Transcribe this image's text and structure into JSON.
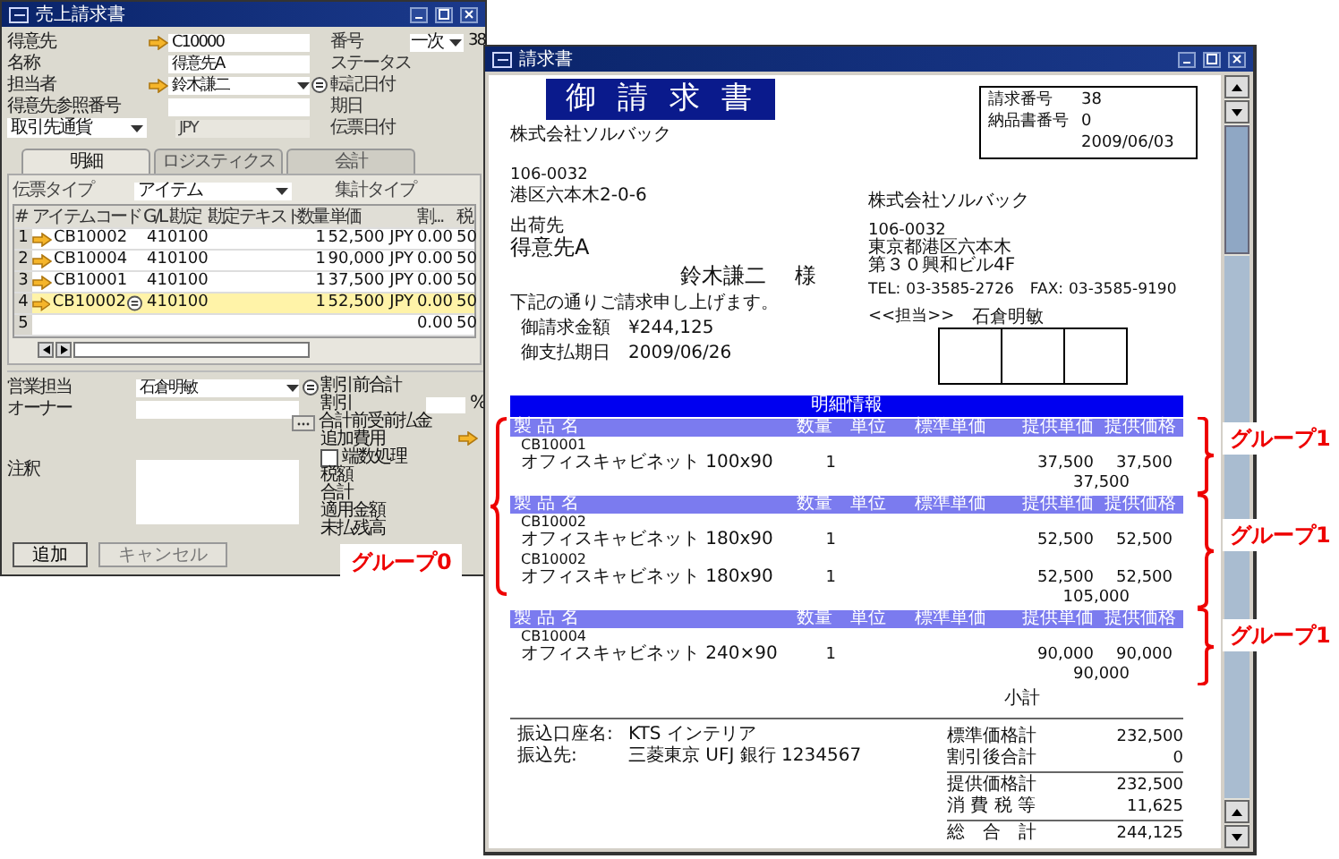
{
  "back_window": {
    "title": "売上請求書",
    "header_left": [
      {
        "label": "得意先",
        "value": "C10000",
        "kind": "link"
      },
      {
        "label": "名称",
        "value": "得意先A",
        "kind": "text"
      },
      {
        "label": "担当者",
        "value": "鈴木謙二",
        "kind": "link-select"
      },
      {
        "label": "得意先参照番号",
        "kind": "text"
      },
      {
        "label": "取引先通貨",
        "value": "JPY",
        "kind": "select-label"
      }
    ],
    "header_right": [
      {
        "label": "番号",
        "value": "一次",
        "extra": "38",
        "kind": "select"
      },
      {
        "label": "ステータス",
        "kind": "plain"
      },
      {
        "label": "転記日付",
        "kind": "plain"
      },
      {
        "label": "期日",
        "kind": "plain"
      },
      {
        "label": "伝票日付",
        "kind": "plain"
      }
    ],
    "tabs": [
      {
        "label": "明細",
        "selected": true
      },
      {
        "label": "ロジスティクス",
        "selected": false
      },
      {
        "label": "会計",
        "selected": false
      }
    ],
    "doc_type": {
      "label": "伝票タイプ",
      "value": "アイテム"
    },
    "summary_type": {
      "label": "集計タイプ"
    },
    "table": {
      "columns": [
        "#",
        "アイテムコード",
        "G/L 勘定",
        "勘定テキスト",
        "数量",
        "単価",
        "割...",
        "税"
      ],
      "rows": [
        {
          "cells": [
            "1",
            "CB10002",
            "410100",
            "",
            "1",
            "52,500 JPY",
            "0.00",
            "50"
          ],
          "selected": false
        },
        {
          "cells": [
            "2",
            "CB10004",
            "410100",
            "",
            "1",
            "90,000 JPY",
            "0.00",
            "50"
          ],
          "selected": false
        },
        {
          "cells": [
            "3",
            "CB10001",
            "410100",
            "",
            "1",
            "37,500 JPY",
            "0.00",
            "50"
          ],
          "selected": false
        },
        {
          "cells": [
            "4",
            "CB10002",
            "410100",
            "",
            "1",
            "52,500 JPY",
            "0.00",
            "50"
          ],
          "selected": true
        },
        {
          "cells": [
            "5",
            "",
            "",
            "",
            "",
            "",
            "0.00",
            "50"
          ],
          "selected": false
        }
      ]
    },
    "bottom_left": [
      {
        "label": "営業担当",
        "value": "石倉明敏",
        "kind": "select"
      },
      {
        "label": "オーナー",
        "kind": "text"
      },
      {
        "label": "注釈",
        "kind": "textarea"
      }
    ],
    "totals": [
      {
        "label": "割引前合計",
        "kind": "plain"
      },
      {
        "label": "割引",
        "kind": "percent",
        "unit": "%"
      },
      {
        "label": "合計前受前払金",
        "kind": "button"
      },
      {
        "label": "追加費用",
        "kind": "link"
      },
      {
        "label": "端数処理",
        "kind": "checkbox",
        "checked": false
      },
      {
        "label": "税額",
        "kind": "plain"
      },
      {
        "label": "合計",
        "kind": "plain"
      },
      {
        "label": "適用金額",
        "kind": "plain"
      },
      {
        "label": "未払残高",
        "kind": "plain"
      }
    ],
    "buttons": [
      "追加",
      "キャンセル"
    ]
  },
  "front_window": {
    "title": "請求書",
    "document": {
      "title": "御請求書",
      "issuer": "株式会社ソルバック",
      "postal": "106-0032",
      "address": "港区六本木2-0-6",
      "ship_to_label": "出荷先",
      "ship_to": "得意先A",
      "contact": "鈴木謙二",
      "honorific": "様",
      "message": "下記の通りご請求申し上げます。",
      "amount_label": "御請求金額",
      "amount": "¥244,125",
      "due_label": "御支払期日",
      "due": "2009/06/26",
      "info": [
        {
          "label": "請求番号",
          "value": "38"
        },
        {
          "label": "納品書番号",
          "value": "0"
        },
        {
          "value": "2009/06/03"
        }
      ],
      "sender": {
        "name": "株式会社ソルバック",
        "postal": "106-0032",
        "address_lines": [
          "東京都港区六本木",
          "第３０興和ビル4F"
        ],
        "tel_label": "TEL:",
        "tel": "03-3585-2726",
        "fax_label": "FAX:",
        "fax": "03-3585-9190",
        "rep_label": "<<担当>>",
        "rep": "石倉明敏"
      },
      "detail": {
        "title": "明細情報",
        "annotation": "グループ0",
        "groups": [
          {
            "annotation": "グループ1",
            "columns": [
              "製 品 名",
              "数量",
              "単位",
              "標準単価",
              "提供単価",
              "提供価格"
            ],
            "subtotal": "37,500",
            "items": [
              {
                "code": "CB10001",
                "name": "オフィスキャビネット 100x90",
                "qty": "1",
                "unit_price": "37,500",
                "price": "37,500"
              }
            ]
          },
          {
            "annotation": "グループ1",
            "columns": [
              "製 品 名",
              "数量",
              "単位",
              "標準単価",
              "提供単価",
              "提供価格"
            ],
            "subtotal": "105,000",
            "items": [
              {
                "code": "CB10002",
                "name": "オフィスキャビネット 180x90",
                "qty": "1",
                "unit_price": "52,500",
                "price": "52,500"
              },
              {
                "code": "CB10002",
                "name": "オフィスキャビネット 180x90",
                "qty": "1",
                "unit_price": "52,500",
                "price": "52,500"
              }
            ]
          },
          {
            "annotation": "グループ1",
            "columns": [
              "製 品 名",
              "数量",
              "単位",
              "標準単価",
              "提供単価",
              "提供価格"
            ],
            "subtotal": "90,000",
            "items": [
              {
                "code": "CB10004",
                "name": "オフィスキャビネット 240×90",
                "qty": "1",
                "unit_price": "90,000",
                "price": "90,000"
              }
            ]
          }
        ],
        "total_label": "小計"
      },
      "bank": [
        {
          "label": "振込口座名:",
          "value": "KTS インテリア"
        },
        {
          "label": "振込先:",
          "value": "三菱東京 UFJ 銀行 1234567"
        }
      ],
      "totals": [
        {
          "items": [
            {
              "label": "標準価格計",
              "value": "232,500"
            },
            {
              "label": "割引後合計",
              "value": "0"
            }
          ]
        },
        {
          "items": [
            {
              "label": "提供価格計",
              "value": "232,500"
            },
            {
              "label": "消 費 税 等",
              "value": "11,625"
            }
          ]
        },
        {
          "items": [
            {
              "label": "総　合　計",
              "value": "244,125"
            }
          ]
        }
      ]
    }
  }
}
